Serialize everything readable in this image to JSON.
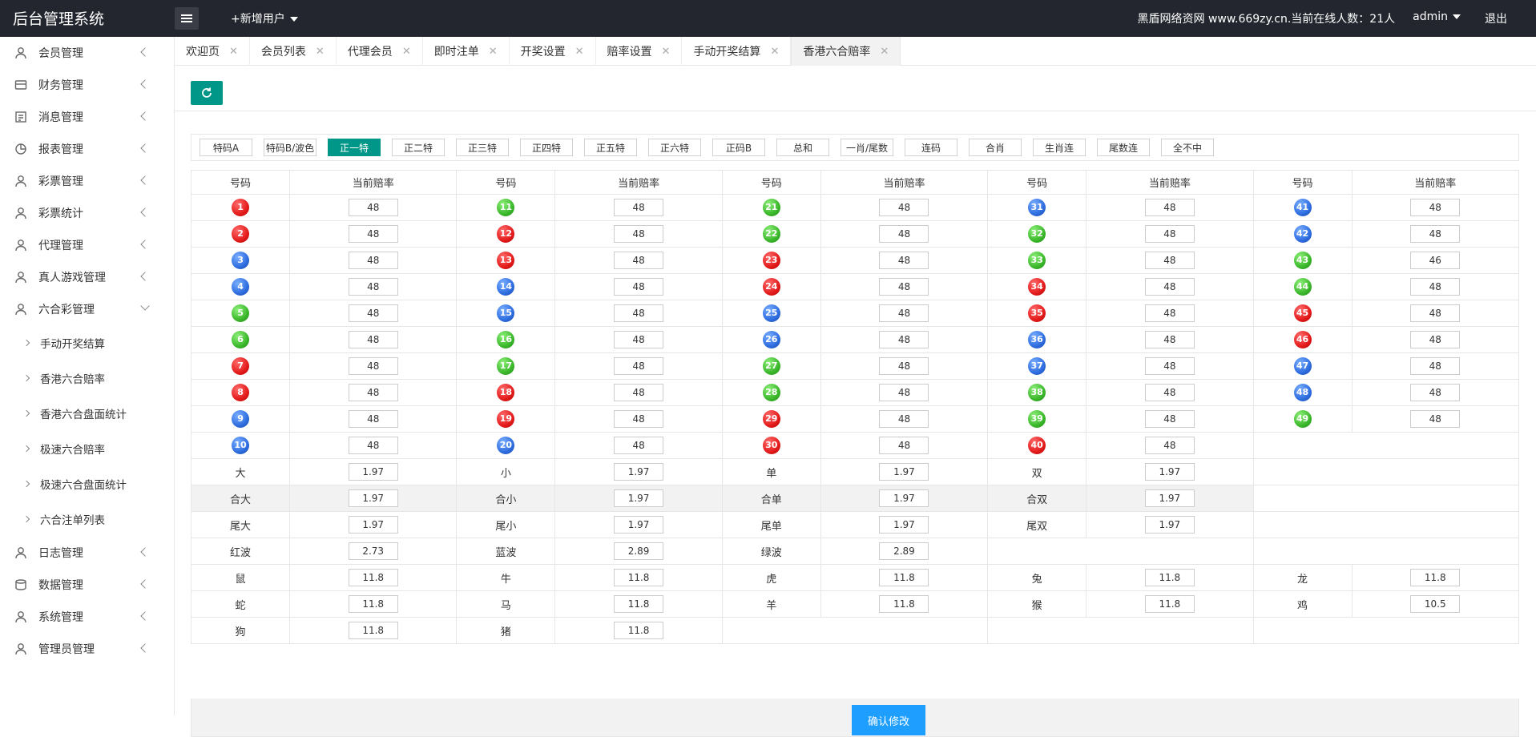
{
  "header": {
    "brand": "后台管理系统",
    "add_user": "+新增用户",
    "online_text": "黑盾网络资网 www.669zy.cn.当前在线人数：21人",
    "admin": "admin",
    "logout": "退出"
  },
  "sidebar": {
    "items": [
      {
        "label": "会员管理",
        "icon": "user-icon"
      },
      {
        "label": "财务管理",
        "icon": "finance-icon"
      },
      {
        "label": "消息管理",
        "icon": "message-icon"
      },
      {
        "label": "报表管理",
        "icon": "report-icon"
      },
      {
        "label": "彩票管理",
        "icon": "user-icon"
      },
      {
        "label": "彩票统计",
        "icon": "user-icon"
      },
      {
        "label": "代理管理",
        "icon": "user-icon"
      },
      {
        "label": "真人游戏管理",
        "icon": "user-icon"
      },
      {
        "label": "六合彩管理",
        "icon": "user-icon",
        "expanded": true
      }
    ],
    "sub_items": [
      "手动开奖结算",
      "香港六合赔率",
      "香港六合盘面统计",
      "极速六合赔率",
      "极速六合盘面统计",
      "六合注单列表"
    ],
    "items_after": [
      {
        "label": "日志管理",
        "icon": "user-icon"
      },
      {
        "label": "数据管理",
        "icon": "data-icon"
      },
      {
        "label": "系统管理",
        "icon": "user-icon"
      },
      {
        "label": "管理员管理",
        "icon": "user-icon"
      }
    ]
  },
  "tabs": [
    {
      "label": "欢迎页"
    },
    {
      "label": "会员列表"
    },
    {
      "label": "代理会员"
    },
    {
      "label": "即时注单"
    },
    {
      "label": "开奖设置"
    },
    {
      "label": "赔率设置"
    },
    {
      "label": "手动开奖结算"
    },
    {
      "label": "香港六合赔率",
      "active": true
    }
  ],
  "filters": [
    "特码A",
    "特码B/波色",
    "正一特",
    "正二特",
    "正三特",
    "正四特",
    "正五特",
    "正六特",
    "正码B",
    "总和",
    "一肖/尾数",
    "连码",
    "合肖",
    "生肖连",
    "尾数连",
    "全不中"
  ],
  "active_filter": "正一特",
  "table": {
    "col_number": "号码",
    "col_odds": "当前赔率",
    "balls": [
      {
        "n": "1",
        "c": "red",
        "o": "48"
      },
      {
        "n": "2",
        "c": "red",
        "o": "48"
      },
      {
        "n": "3",
        "c": "blue",
        "o": "48"
      },
      {
        "n": "4",
        "c": "blue",
        "o": "48"
      },
      {
        "n": "5",
        "c": "green",
        "o": "48"
      },
      {
        "n": "6",
        "c": "green",
        "o": "48"
      },
      {
        "n": "7",
        "c": "red",
        "o": "48"
      },
      {
        "n": "8",
        "c": "red",
        "o": "48"
      },
      {
        "n": "9",
        "c": "blue",
        "o": "48"
      },
      {
        "n": "10",
        "c": "blue",
        "o": "48"
      },
      {
        "n": "11",
        "c": "green",
        "o": "48"
      },
      {
        "n": "12",
        "c": "red",
        "o": "48"
      },
      {
        "n": "13",
        "c": "red",
        "o": "48"
      },
      {
        "n": "14",
        "c": "blue",
        "o": "48"
      },
      {
        "n": "15",
        "c": "blue",
        "o": "48"
      },
      {
        "n": "16",
        "c": "green",
        "o": "48"
      },
      {
        "n": "17",
        "c": "green",
        "o": "48"
      },
      {
        "n": "18",
        "c": "red",
        "o": "48"
      },
      {
        "n": "19",
        "c": "red",
        "o": "48"
      },
      {
        "n": "20",
        "c": "blue",
        "o": "48"
      },
      {
        "n": "21",
        "c": "green",
        "o": "48"
      },
      {
        "n": "22",
        "c": "green",
        "o": "48"
      },
      {
        "n": "23",
        "c": "red",
        "o": "48"
      },
      {
        "n": "24",
        "c": "red",
        "o": "48"
      },
      {
        "n": "25",
        "c": "blue",
        "o": "48"
      },
      {
        "n": "26",
        "c": "blue",
        "o": "48"
      },
      {
        "n": "27",
        "c": "green",
        "o": "48"
      },
      {
        "n": "28",
        "c": "green",
        "o": "48"
      },
      {
        "n": "29",
        "c": "red",
        "o": "48"
      },
      {
        "n": "30",
        "c": "red",
        "o": "48"
      },
      {
        "n": "31",
        "c": "blue",
        "o": "48"
      },
      {
        "n": "32",
        "c": "green",
        "o": "48"
      },
      {
        "n": "33",
        "c": "green",
        "o": "48"
      },
      {
        "n": "34",
        "c": "red",
        "o": "48"
      },
      {
        "n": "35",
        "c": "red",
        "o": "48"
      },
      {
        "n": "36",
        "c": "blue",
        "o": "48"
      },
      {
        "n": "37",
        "c": "blue",
        "o": "48"
      },
      {
        "n": "38",
        "c": "green",
        "o": "48"
      },
      {
        "n": "39",
        "c": "green",
        "o": "48"
      },
      {
        "n": "40",
        "c": "red",
        "o": "48"
      },
      {
        "n": "41",
        "c": "blue",
        "o": "48"
      },
      {
        "n": "42",
        "c": "blue",
        "o": "48"
      },
      {
        "n": "43",
        "c": "green",
        "o": "46"
      },
      {
        "n": "44",
        "c": "green",
        "o": "48"
      },
      {
        "n": "45",
        "c": "red",
        "o": "48"
      },
      {
        "n": "46",
        "c": "red",
        "o": "48"
      },
      {
        "n": "47",
        "c": "blue",
        "o": "48"
      },
      {
        "n": "48",
        "c": "blue",
        "o": "48"
      },
      {
        "n": "49",
        "c": "green",
        "o": "48"
      }
    ],
    "extra_rows": [
      {
        "gray": false,
        "cells": [
          {
            "l": "大",
            "o": "1.97"
          },
          {
            "l": "小",
            "o": "1.97"
          },
          {
            "l": "单",
            "o": "1.97"
          },
          {
            "l": "双",
            "o": "1.97"
          }
        ]
      },
      {
        "gray": true,
        "cells": [
          {
            "l": "合大",
            "o": "1.97"
          },
          {
            "l": "合小",
            "o": "1.97"
          },
          {
            "l": "合单",
            "o": "1.97"
          },
          {
            "l": "合双",
            "o": "1.97"
          }
        ]
      },
      {
        "gray": false,
        "cells": [
          {
            "l": "尾大",
            "o": "1.97"
          },
          {
            "l": "尾小",
            "o": "1.97"
          },
          {
            "l": "尾单",
            "o": "1.97"
          },
          {
            "l": "尾双",
            "o": "1.97"
          }
        ]
      },
      {
        "gray": false,
        "cells": [
          {
            "l": "红波",
            "o": "2.73"
          },
          {
            "l": "蓝波",
            "o": "2.89"
          },
          {
            "l": "绿波",
            "o": "2.89"
          }
        ]
      },
      {
        "gray": false,
        "cells": [
          {
            "l": "鼠",
            "o": "11.8"
          },
          {
            "l": "牛",
            "o": "11.8"
          },
          {
            "l": "虎",
            "o": "11.8"
          },
          {
            "l": "兔",
            "o": "11.8"
          },
          {
            "l": "龙",
            "o": "11.8"
          }
        ]
      },
      {
        "gray": false,
        "cells": [
          {
            "l": "蛇",
            "o": "11.8"
          },
          {
            "l": "马",
            "o": "11.8"
          },
          {
            "l": "羊",
            "o": "11.8"
          },
          {
            "l": "猴",
            "o": "11.8"
          },
          {
            "l": "鸡",
            "o": "10.5"
          }
        ]
      },
      {
        "gray": false,
        "cells": [
          {
            "l": "狗",
            "o": "11.8"
          },
          {
            "l": "猪",
            "o": "11.8"
          }
        ]
      }
    ]
  },
  "confirm_label": "确认修改"
}
